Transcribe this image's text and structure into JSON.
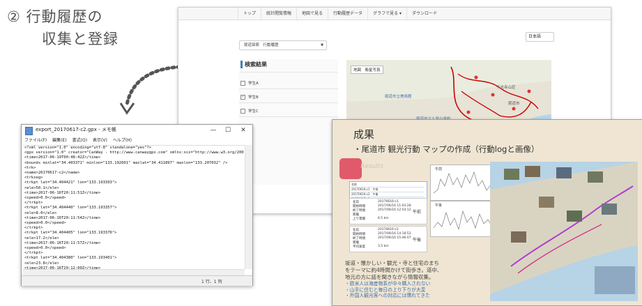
{
  "heading": {
    "line1": "② 行動履歴の",
    "line2": "収集と登録"
  },
  "web": {
    "nav": [
      "トップ",
      "統計閲覧情報",
      "地図で見る",
      "行動履歴データ",
      "グラフで見る ▾",
      "ダウンロード"
    ],
    "lang_select": "日本語",
    "breadcrumb": "尾道探索　行動履歴",
    "panel_title": "検索結果",
    "checkboxes": [
      {
        "label": "学生A",
        "checked": false
      },
      {
        "label": "学生B",
        "checked": true
      },
      {
        "label": "学生C",
        "checked": false
      }
    ],
    "map_tab": "地図　衛星写真",
    "map_labels": [
      "尾道市立美術館",
      "千光寺山荘",
      "尾道市",
      "尾道市立土堂小学校"
    ]
  },
  "notepad": {
    "title": "export_20170617-c2.gpx - メモ帳",
    "menu": [
      "ファイル(F)",
      "編集(E)",
      "書式(O)",
      "表示(V)",
      "ヘルプ(H)"
    ],
    "btn_min": "—",
    "btn_max": "☐",
    "btn_close": "✕",
    "content": "<?xml version=\"1.0\" encoding=\"utf-8\" standalone=\"yes\"?>\n<gpx version=\"1.0\" creator=\"CanWay - http://www.canwaygps.com\" xmlns:xsi=\"http://www.w3.org/200\n<time>2017-06-19T00:48:42Z</time>\n<bounds minlat=\"34.403371\" minlon=\"133.192601\" maxlat=\"34.411897\" maxlon=\"133.207032\" />\n<trk>\n<name>20170617-c2</name>\n<trkseg>\n<trkpt lat=\"34.404421\" lon=\"133.193393\">\n<ele>50.1</ele>\n<time>2017-06-16T20:11:51Z</time>\n<speed>0.0</speed>\n</trkpt>\n<trkpt lat=\"34.404440\" lon=\"133.193357\">\n<ele>8.0</ele>\n<time>2017-06-16T20:11:54Z</time>\n<speed>0.0</speed>\n</trkpt>\n<trkpt lat=\"34.404405\" lon=\"133.193376\">\n<ele>17.2</ele>\n<time>2017-06-16T20:11:57Z</time>\n<speed>0.0</speed>\n</trkpt>\n<trkpt lat=\"34.404380\" lon=\"133.193401\">\n<ele>23.8</ele>\n<time>2017-06-16T20:12:00Z</time>\n<speed>0.0</speed>",
    "status": "1 行、1 列"
  },
  "slide": {
    "title": "成果",
    "bullet": "・尾道市 観光行動 マップの作成（行動logと画像）",
    "results_word": "Results",
    "table_rows": [
      "名前",
      "20170616-c1　午前",
      "20170616-c2　午後",
      "20170617-c1"
    ],
    "card1": {
      "lines": [
        "名前",
        "開始時間",
        "終了時間",
        "距離",
        "上り累積"
      ],
      "values": [
        "20170616-c1",
        "2017/06/16 11:03:28",
        "2017/06/16 12:54:12",
        "6.5 km"
      ],
      "tag": "午前"
    },
    "card2": {
      "lines": [
        "名前",
        "開始時間",
        "終了時間",
        "距離",
        "平均速度"
      ],
      "values": [
        "20170616-c2",
        "2017/06/16 14:18:52",
        "2017/06/16 15:46:07",
        "3.5 km"
      ],
      "tag": "午後"
    },
    "graph_labels": [
      "午前",
      "午後"
    ],
    "note1": [
      "坂道・懐かしい・観光・寺と住宅のまち",
      "をテーマに約4時間かけて街歩き。道中、",
      "地元の方に話を聞きながら情報収集。"
    ],
    "note2": [
      "・欧米人は海産物系が中々購入されない",
      "・山手に住むと毎日の上り下りが大変",
      "・外国人観光客への対応には慣れてきた"
    ]
  }
}
